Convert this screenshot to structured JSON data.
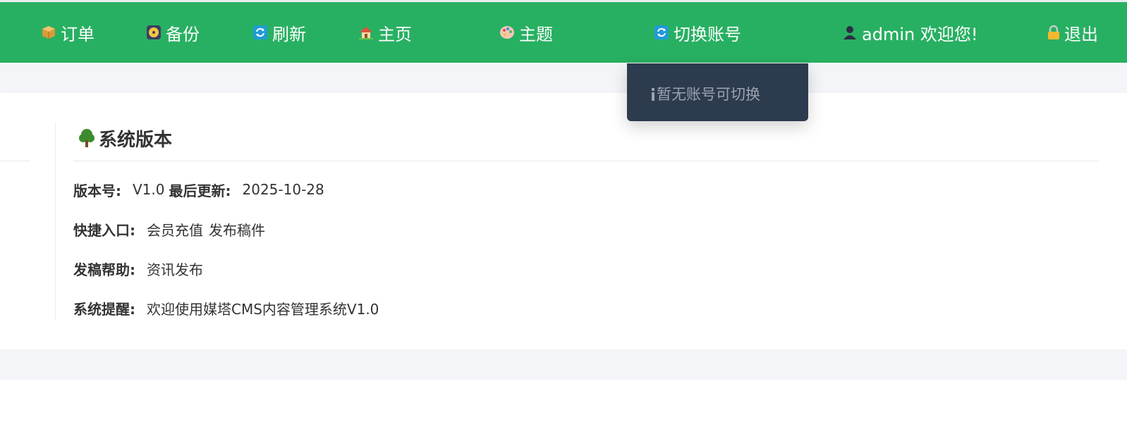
{
  "nav": {
    "orders": "订单",
    "backup": "备份",
    "refresh": "刷新",
    "home": "主页",
    "theme": "主题",
    "switch_account": "切换账号",
    "user_greeting": "admin 欢迎您!",
    "logout": "退出"
  },
  "dropdown": {
    "empty_message": "暂无账号可切换"
  },
  "section": {
    "title": "系统版本",
    "version_label": "版本号:",
    "version_value": "V1.0",
    "updated_label": "最后更新:",
    "updated_value": "2025-10-28",
    "shortcuts_label": "快捷入口:",
    "shortcut_1": "会员充值",
    "shortcut_2": "发布稿件",
    "help_label": "发稿帮助:",
    "help_link": "资讯发布",
    "notice_label": "系统提醒:",
    "notice_value": "欢迎使用媒塔CMS内容管理系统V1.0"
  },
  "colors": {
    "topbar": "#28b062",
    "dropdown": "#2d3b4f",
    "band": "#f4f5f9"
  },
  "icons": [
    "package-icon",
    "disk-icon",
    "refresh-icon",
    "house-icon",
    "palette-icon",
    "refresh-icon",
    "user-icon",
    "lock-icon",
    "info-icon",
    "tree-icon"
  ]
}
